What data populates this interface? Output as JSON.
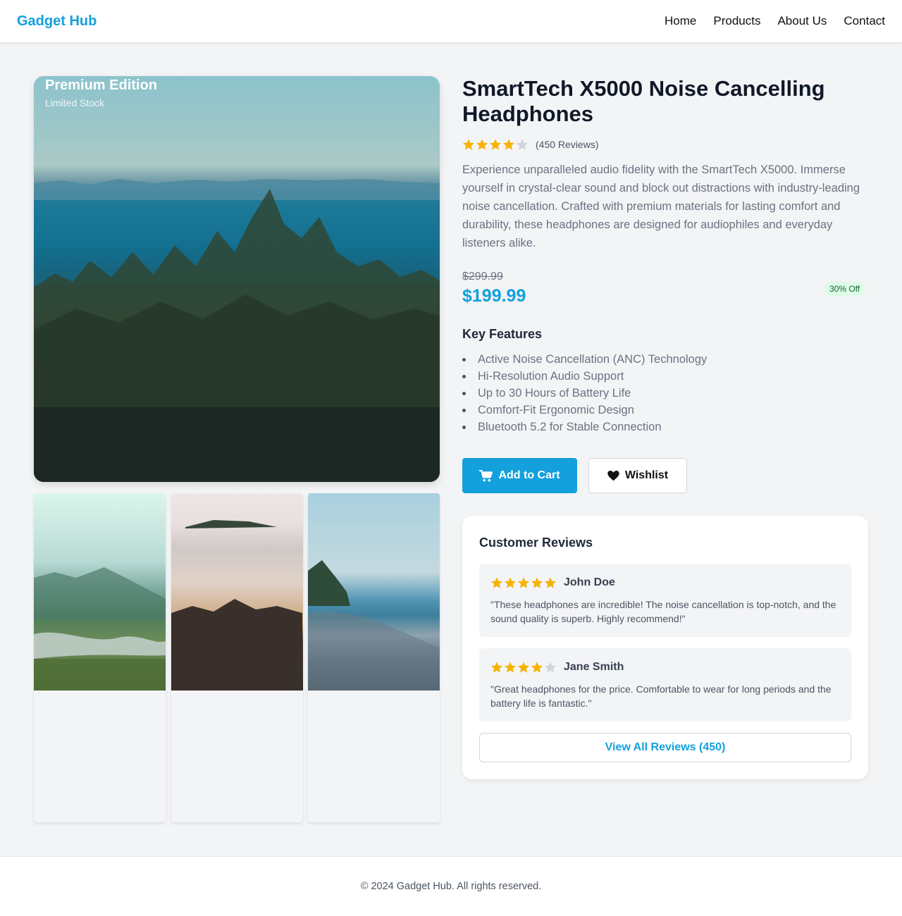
{
  "header": {
    "brand": "Gadget Hub",
    "nav": [
      "Home",
      "Products",
      "About Us",
      "Contact"
    ]
  },
  "gallery": {
    "badge_title": "Premium Edition",
    "badge_subtitle": "Limited Stock"
  },
  "product": {
    "title": "SmartTech X5000 Noise Cancelling Headphones",
    "rating": 4,
    "rating_max": 5,
    "review_count_text": "(450 Reviews)",
    "description": "Experience unparalleled audio fidelity with the SmartTech X5000. Immerse yourself in crystal-clear sound and block out distractions with industry-leading noise cancellation. Crafted with premium materials for lasting comfort and durability, these headphones are designed for audiophiles and everyday listeners alike.",
    "old_price": "$299.99",
    "price": "$199.99",
    "discount": "30% Off",
    "features_title": "Key Features",
    "features": [
      "Active Noise Cancellation (ANC) Technology",
      "Hi-Resolution Audio Support",
      "Up to 30 Hours of Battery Life",
      "Comfort-Fit Ergonomic Design",
      "Bluetooth 5.2 for Stable Connection"
    ],
    "add_to_cart": "Add to Cart",
    "wishlist": "Wishlist"
  },
  "reviews": {
    "title": "Customer Reviews",
    "items": [
      {
        "name": "John Doe",
        "rating": 5,
        "text": "\"These headphones are incredible! The noise cancellation is top-notch, and the sound quality is superb. Highly recommend!\""
      },
      {
        "name": "Jane Smith",
        "rating": 4,
        "text": "\"Great headphones for the price. Comfortable to wear for long periods and the battery life is fantastic.\""
      }
    ],
    "view_all": "View All Reviews (450)"
  },
  "footer": {
    "text": "© 2024 Gadget Hub. All rights reserved."
  },
  "colors": {
    "accent": "#13a0dd",
    "star_filled": "#f5b301",
    "star_empty": "#d1d5db",
    "discount_bg": "#dcfce7",
    "discount_text": "#166534"
  },
  "icons": [
    "cart-icon",
    "heart-icon",
    "star-icon"
  ]
}
